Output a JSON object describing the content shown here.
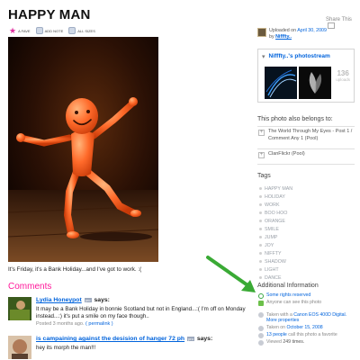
{
  "page": {
    "title": "HAPPY MAN",
    "share_label": "Share This"
  },
  "toolbar": {
    "items": [
      {
        "label": "A FAVE",
        "icon": "star-icon"
      },
      {
        "label": "ADD NOTE",
        "icon": "note-icon"
      },
      {
        "label": "ALL SIZES",
        "icon": "sizes-icon"
      }
    ]
  },
  "photo": {
    "caption": "It's Friday, it's a Bank Holiday...and I've got to work. :("
  },
  "comments": {
    "heading": "Comments",
    "items": [
      {
        "author": "Lydia Honeypot",
        "badge": "pro",
        "says": "says:",
        "text": "It may be a Bank Holiday in bonnie Scotland but not in England...:( I'm off on Monday instead...:) it's put a smile on my face though..",
        "posted": "Posted 3 months ago.",
        "permalink": "( permalink )"
      },
      {
        "author": "is campaining against the desision of hanger 72 ph",
        "badge": "pro",
        "says": "says:",
        "text": "hey its morph the man!!!"
      }
    ]
  },
  "sidebar": {
    "uploaded_prefix": "Uploaded on",
    "uploaded_date": "April 30, 2009",
    "by_prefix": "by",
    "uploader": "Nifffty..",
    "photostream_title": "Nifffty..'s photostream",
    "uploads_count": "136",
    "uploads_label": "uploads",
    "belongs_heading": "This photo also belongs to:",
    "pools": [
      "The World Through My Eyes - Post 1 / Comment Any 1 (Pool)",
      "ClanFlickr (Pool)"
    ],
    "tags_heading": "Tags",
    "tags": [
      "HAPPY MAN",
      "HOLIDAY",
      "WORK",
      "BOO HOO",
      "ORANGE",
      "SMILE",
      "JUMP",
      "JOY",
      "NIFFTY",
      "SHADOW",
      "LIGHT",
      "DANCE"
    ],
    "additional_heading": "Additional Information",
    "license": "Some rights reserved",
    "visibility": "Anyone can see this photo",
    "taken_prefix": "Taken with a",
    "camera": "Canon EOS 400D Digital.",
    "more_properties": "More properties",
    "taken_on_prefix": "Taken on",
    "taken_on": "October 15, 2008",
    "favorites": "13 people",
    "favorites_suffix": "call this photo a favorite",
    "viewed_prefix": "Viewed",
    "viewed_count": "249 times."
  },
  "colors": {
    "link": "#0063dc",
    "comments_heading": "#ff1a9b",
    "arrow": "#3aaa35",
    "figure": "#ff6a2a"
  }
}
